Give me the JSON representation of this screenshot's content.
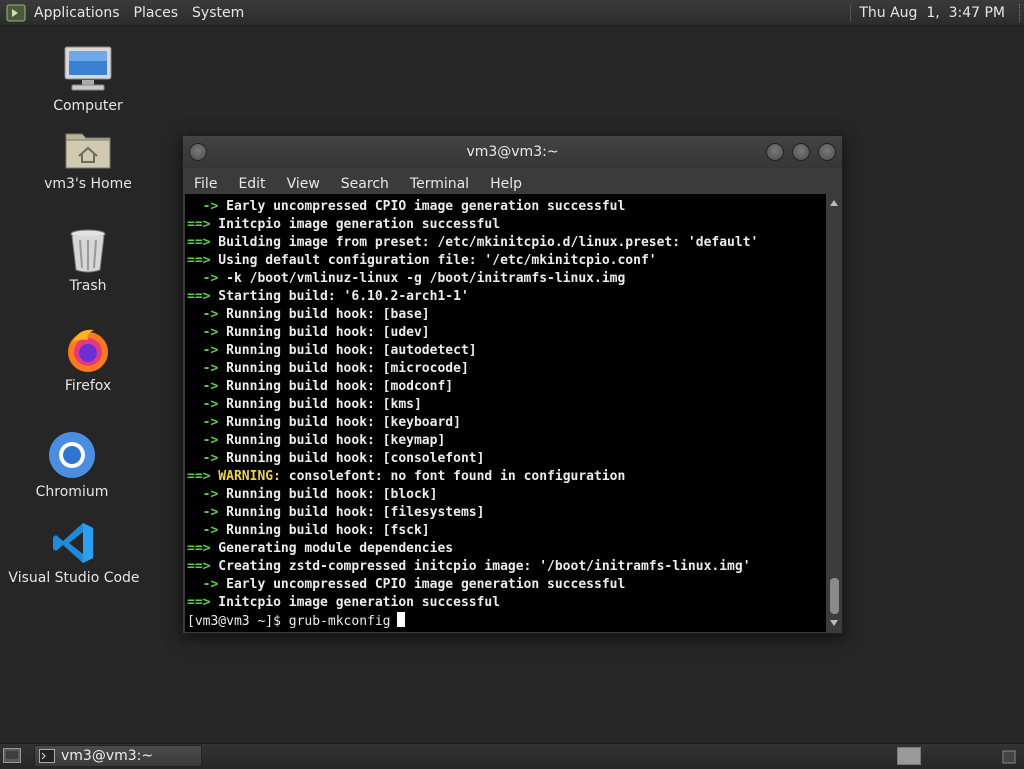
{
  "top_panel": {
    "menus": [
      "Applications",
      "Places",
      "System"
    ],
    "clock": "Thu Aug  1,  3:47 PM"
  },
  "desktop_icons": [
    {
      "label": "Computer",
      "icon": "computer-icon"
    },
    {
      "label": "vm3's Home",
      "icon": "home-folder-icon"
    },
    {
      "label": "Trash",
      "icon": "trash-icon"
    },
    {
      "label": "Firefox",
      "icon": "firefox-icon"
    },
    {
      "label": "Chromium",
      "icon": "chromium-icon"
    },
    {
      "label": "Visual Studio Code",
      "icon": "vscode-icon"
    }
  ],
  "terminal": {
    "title": "vm3@vm3:~",
    "menu": [
      "File",
      "Edit",
      "View",
      "Search",
      "Terminal",
      "Help"
    ],
    "lines": [
      {
        "prefix": "  ->",
        "kind": "sub",
        "text": " Early uncompressed CPIO image generation successful"
      },
      {
        "prefix": "==>",
        "kind": "main",
        "text": " Initcpio image generation successful"
      },
      {
        "prefix": "==>",
        "kind": "main",
        "text": " Building image from preset: /etc/mkinitcpio.d/linux.preset: 'default'"
      },
      {
        "prefix": "==>",
        "kind": "main",
        "text": " Using default configuration file: '/etc/mkinitcpio.conf'"
      },
      {
        "prefix": "  ->",
        "kind": "sub",
        "text": " -k /boot/vmlinuz-linux -g /boot/initramfs-linux.img"
      },
      {
        "prefix": "==>",
        "kind": "main",
        "text": " Starting build: '6.10.2-arch1-1'"
      },
      {
        "prefix": "  ->",
        "kind": "sub",
        "text": " Running build hook: [base]"
      },
      {
        "prefix": "  ->",
        "kind": "sub",
        "text": " Running build hook: [udev]"
      },
      {
        "prefix": "  ->",
        "kind": "sub",
        "text": " Running build hook: [autodetect]"
      },
      {
        "prefix": "  ->",
        "kind": "sub",
        "text": " Running build hook: [microcode]"
      },
      {
        "prefix": "  ->",
        "kind": "sub",
        "text": " Running build hook: [modconf]"
      },
      {
        "prefix": "  ->",
        "kind": "sub",
        "text": " Running build hook: [kms]"
      },
      {
        "prefix": "  ->",
        "kind": "sub",
        "text": " Running build hook: [keyboard]"
      },
      {
        "prefix": "  ->",
        "kind": "sub",
        "text": " Running build hook: [keymap]"
      },
      {
        "prefix": "  ->",
        "kind": "sub",
        "text": " Running build hook: [consolefont]"
      },
      {
        "prefix": "==>",
        "kind": "warn",
        "warn": " WARNING:",
        "text": " consolefont: no font found in configuration"
      },
      {
        "prefix": "  ->",
        "kind": "sub",
        "text": " Running build hook: [block]"
      },
      {
        "prefix": "  ->",
        "kind": "sub",
        "text": " Running build hook: [filesystems]"
      },
      {
        "prefix": "  ->",
        "kind": "sub",
        "text": " Running build hook: [fsck]"
      },
      {
        "prefix": "==>",
        "kind": "main",
        "text": " Generating module dependencies"
      },
      {
        "prefix": "==>",
        "kind": "main",
        "text": " Creating zstd-compressed initcpio image: '/boot/initramfs-linux.img'"
      },
      {
        "prefix": "  ->",
        "kind": "sub",
        "text": " Early uncompressed CPIO image generation successful"
      },
      {
        "prefix": "==>",
        "kind": "main",
        "text": " Initcpio image generation successful"
      }
    ],
    "prompt": "[vm3@vm3 ~]$ ",
    "command": "grub-mkconfig"
  },
  "taskbar": {
    "tasks": [
      {
        "label": "vm3@vm3:~",
        "icon": "terminal-icon"
      }
    ]
  },
  "colors": {
    "arrow": "#5ad04a",
    "warning": "#f2d14a",
    "terminal_bg": "#000000",
    "desktop_bg": "#262626"
  }
}
